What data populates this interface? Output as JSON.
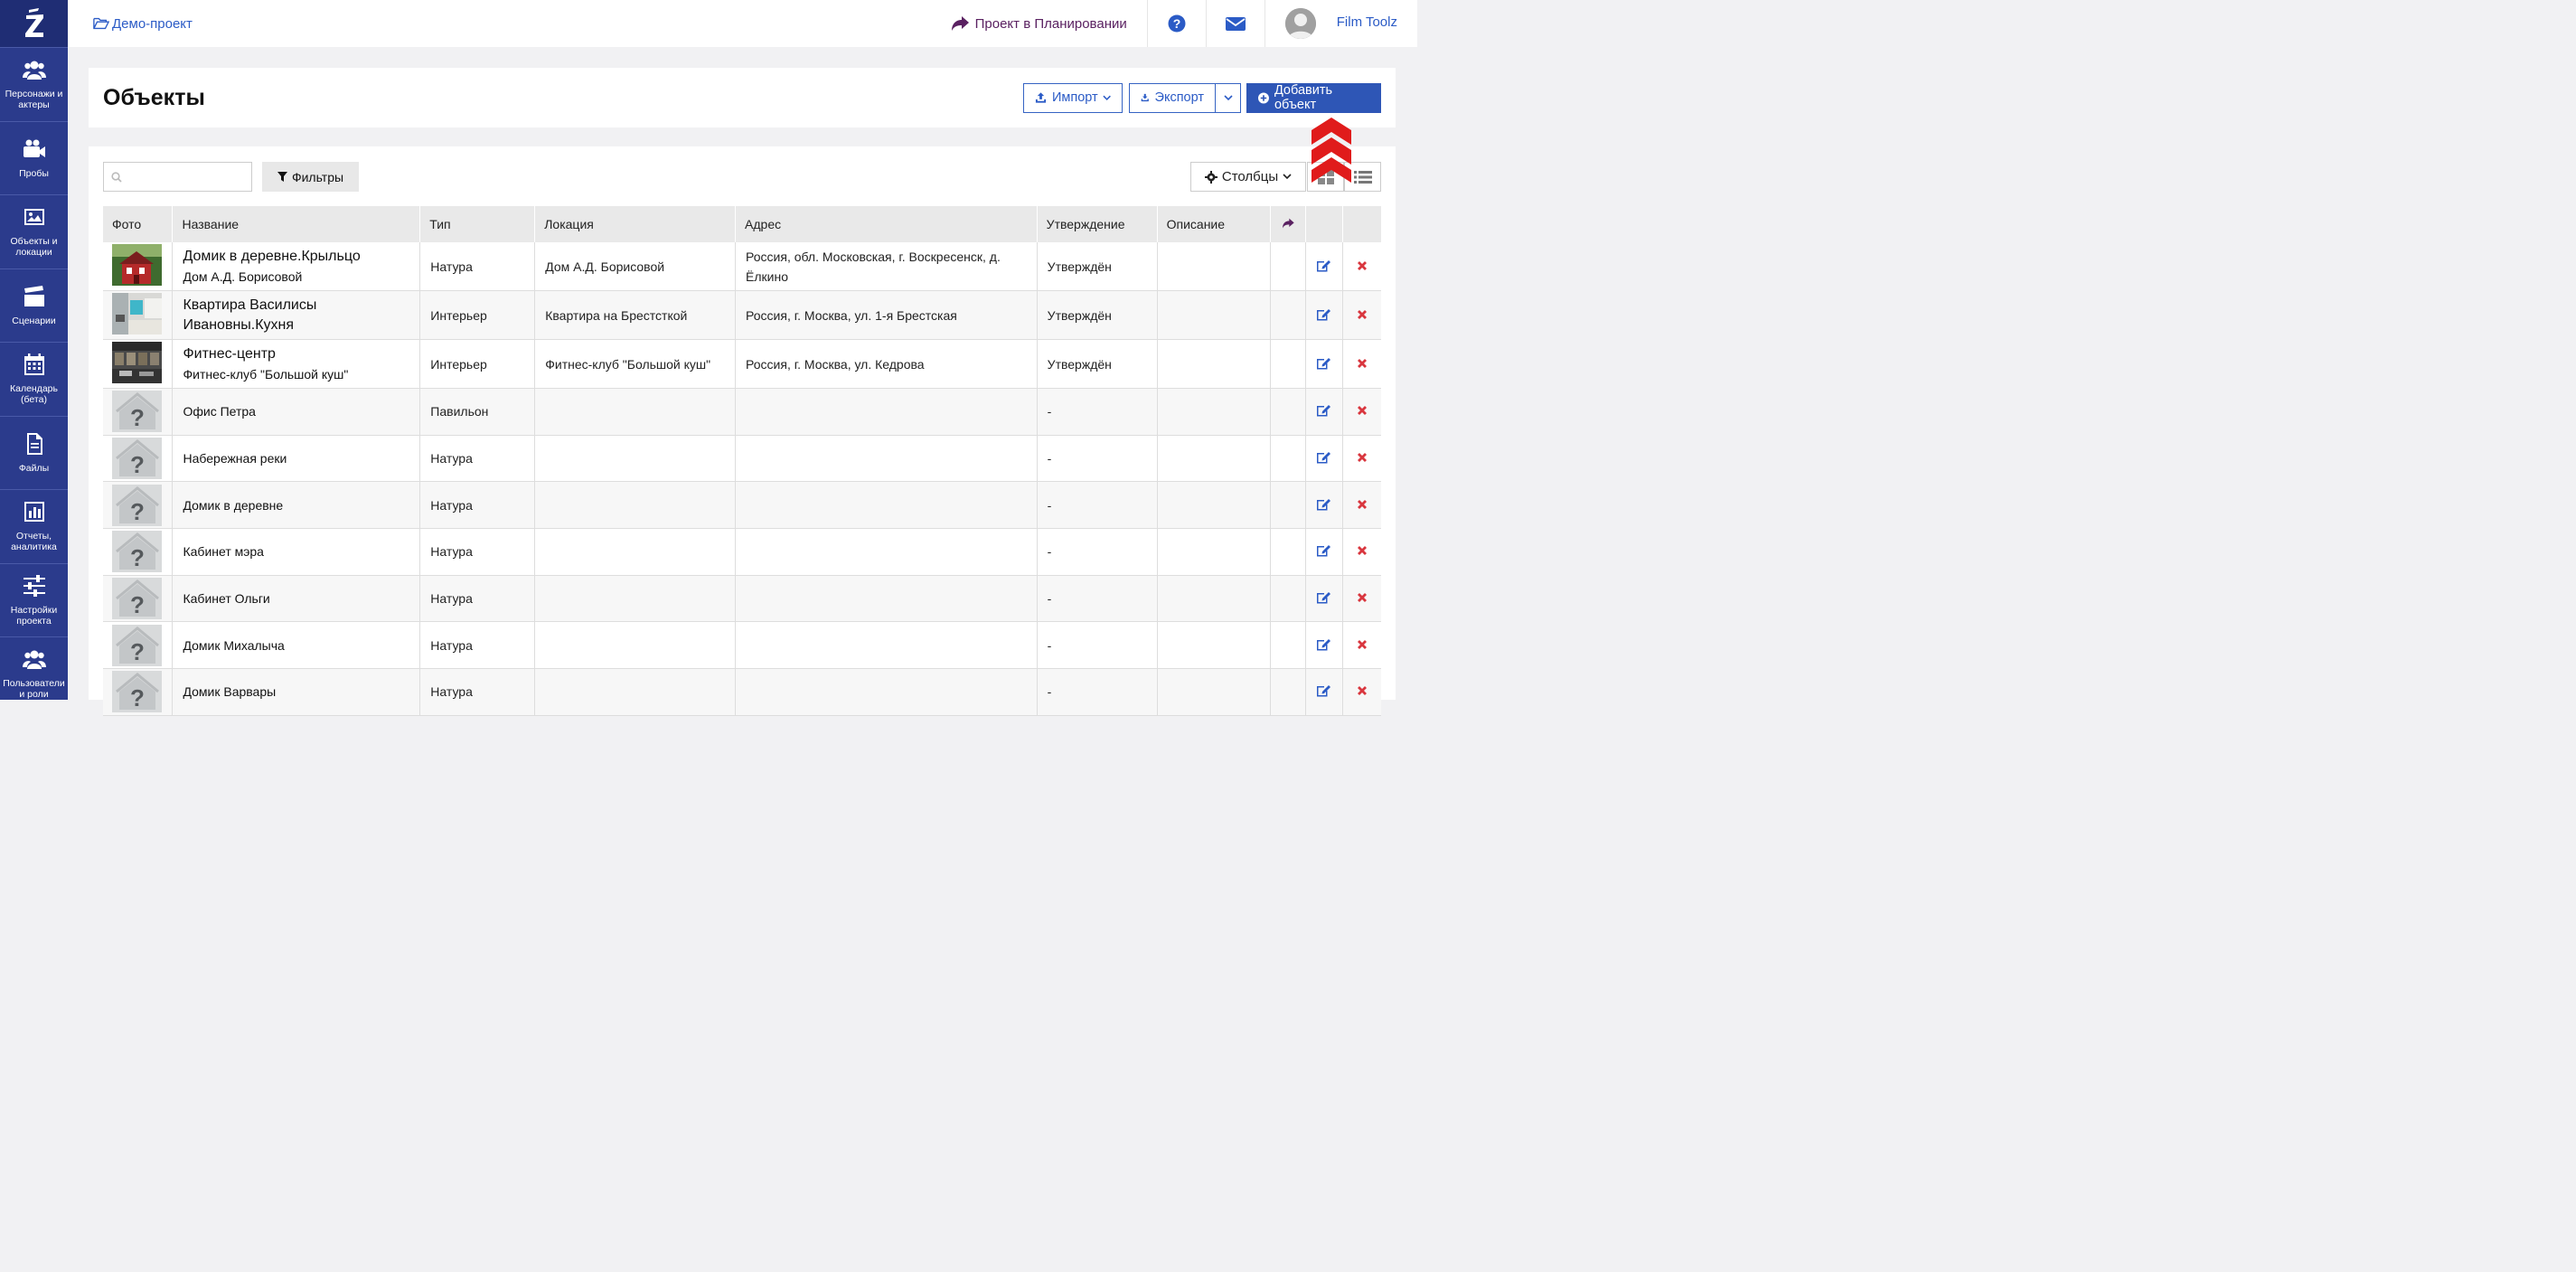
{
  "app": {
    "brand_letter": "Z"
  },
  "sidebar": {
    "items": [
      {
        "label": "Персонажи и актеры",
        "icon": "users-icon"
      },
      {
        "label": "Пробы",
        "icon": "video-camera-icon"
      },
      {
        "label": "Объекты и локации",
        "icon": "image-icon"
      },
      {
        "label": "Сценарии",
        "icon": "clapperboard-icon"
      },
      {
        "label": "Календарь (бета)",
        "icon": "calendar-icon"
      },
      {
        "label": "Файлы",
        "icon": "file-icon"
      },
      {
        "label": "Отчеты, аналитика",
        "icon": "bar-chart-icon"
      },
      {
        "label": "Настройки проекта",
        "icon": "sliders-icon"
      },
      {
        "label": "Пользователи и роли",
        "icon": "users-icon"
      }
    ]
  },
  "topbar": {
    "project_name": "Демо-проект",
    "status_label": "Проект в Планировании",
    "user_name": "Film Toolz",
    "status_color": "#5a2161",
    "link_color": "#2b5bc6"
  },
  "header": {
    "title": "Объекты",
    "import_label": "Импорт",
    "export_label": "Экспорт",
    "add_label": "Добавить объект"
  },
  "toolbar": {
    "search_placeholder": "",
    "filters_label": "Фильтры",
    "columns_label": "Столбцы"
  },
  "table": {
    "columns": [
      "Фото",
      "Название",
      "Тип",
      "Локация",
      "Адрес",
      "Утверждение",
      "Описание"
    ],
    "rows": [
      {
        "photo": "house",
        "title": "Домик в деревне.Крыльцо",
        "subtitle": "Дом А.Д. Борисовой",
        "type": "Натура",
        "location": "Дом А.Д. Борисовой",
        "address": "Россия, обл. Московская, г. Воскресенск, д. Ёлкино",
        "approval": "Утверждён",
        "description": ""
      },
      {
        "photo": "kitchen",
        "title": "Квартира Василисы Ивановны.Кухня",
        "subtitle": "",
        "type": "Интерьер",
        "location": "Квартира на Брестсткой",
        "address": "Россия, г. Москва, ул. 1-я Брестская",
        "approval": "Утверждён",
        "description": ""
      },
      {
        "photo": "gym",
        "title": "Фитнес-центр",
        "subtitle": "Фитнес-клуб \"Большой куш\"",
        "type": "Интерьер",
        "location": "Фитнес-клуб \"Большой куш\"",
        "address": "Россия, г. Москва, ул. Кедрова",
        "approval": "Утверждён",
        "description": ""
      },
      {
        "photo": "placeholder",
        "title": "",
        "subtitle": "Офис Петра",
        "type": "Павильон",
        "location": "",
        "address": "",
        "approval": "-",
        "description": ""
      },
      {
        "photo": "placeholder",
        "title": "",
        "subtitle": "Набережная реки",
        "type": "Натура",
        "location": "",
        "address": "",
        "approval": "-",
        "description": ""
      },
      {
        "photo": "placeholder",
        "title": "",
        "subtitle": "Домик в деревне",
        "type": "Натура",
        "location": "",
        "address": "",
        "approval": "-",
        "description": ""
      },
      {
        "photo": "placeholder",
        "title": "",
        "subtitle": "Кабинет мэра",
        "type": "Натура",
        "location": "",
        "address": "",
        "approval": "-",
        "description": ""
      },
      {
        "photo": "placeholder",
        "title": "",
        "subtitle": "Кабинет Ольги",
        "type": "Натура",
        "location": "",
        "address": "",
        "approval": "-",
        "description": ""
      },
      {
        "photo": "placeholder",
        "title": "",
        "subtitle": "Домик Михалыча",
        "type": "Натура",
        "location": "",
        "address": "",
        "approval": "-",
        "description": ""
      },
      {
        "photo": "placeholder",
        "title": "",
        "subtitle": "Домик Варвары",
        "type": "Натура",
        "location": "",
        "address": "",
        "approval": "-",
        "description": ""
      }
    ]
  }
}
